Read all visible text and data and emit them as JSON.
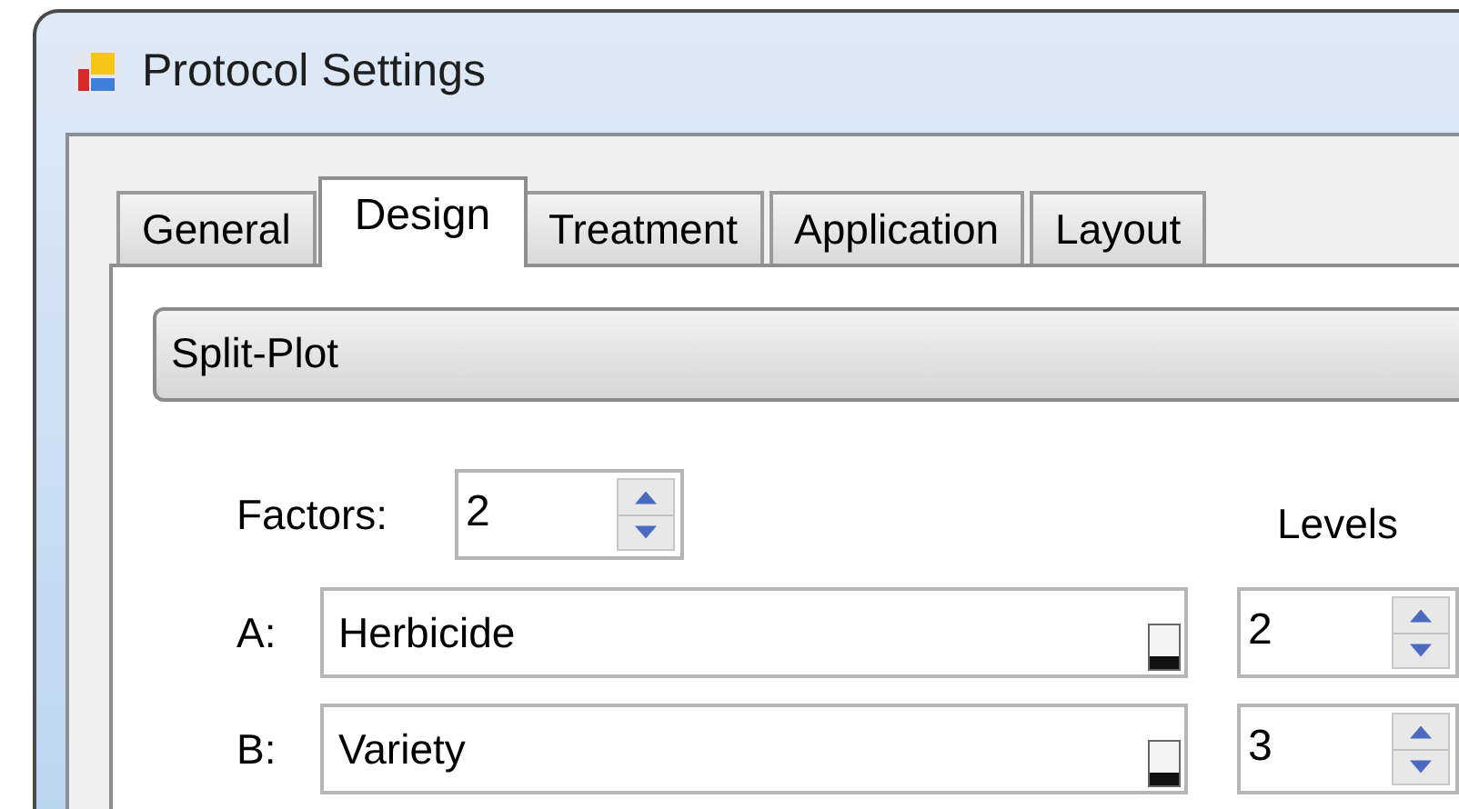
{
  "window": {
    "title": "Protocol Settings"
  },
  "tabs": [
    {
      "label": "General",
      "selected": false
    },
    {
      "label": "Design",
      "selected": true
    },
    {
      "label": "Treatment",
      "selected": false
    },
    {
      "label": "Application",
      "selected": false
    },
    {
      "label": "Layout",
      "selected": false
    }
  ],
  "design_type": {
    "value": "Split-Plot"
  },
  "factors": {
    "label": "Factors:",
    "value": "2"
  },
  "levels_header": "Levels",
  "factor_rows": [
    {
      "label": "A:",
      "name": "Herbicide",
      "levels": "2"
    },
    {
      "label": "B:",
      "name": "Variety",
      "levels": "3"
    }
  ]
}
